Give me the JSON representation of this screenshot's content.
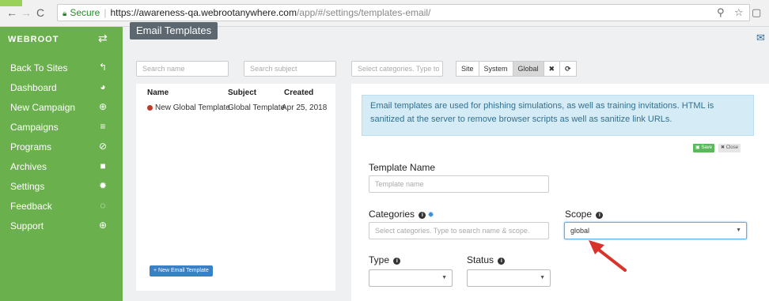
{
  "browser": {
    "secure_label": "Secure",
    "url_host": "https://awareness-qa.webrootanywhere.com",
    "url_path": "/app/#/settings/templates-email/"
  },
  "sidebar": {
    "brand": "WEBROOT",
    "items": [
      {
        "label": "Back To Sites",
        "icon": "↰"
      },
      {
        "label": "Dashboard",
        "icon": "◕"
      },
      {
        "label": "New Campaign",
        "icon": "⊕"
      },
      {
        "label": "Campaigns",
        "icon": "≡"
      },
      {
        "label": "Programs",
        "icon": "⊘"
      },
      {
        "label": "Archives",
        "icon": "■"
      },
      {
        "label": "Settings",
        "icon": "✹"
      },
      {
        "label": "Feedback",
        "icon": "◌"
      },
      {
        "label": "Support",
        "icon": "⊕"
      }
    ]
  },
  "page": {
    "title": "Email Templates"
  },
  "filters": {
    "search_name_placeholder": "Search name",
    "search_subject_placeholder": "Search subject",
    "categories_placeholder": "Select categories. Type to",
    "buttons": [
      "Site",
      "System",
      "Global"
    ],
    "clear_icon": "✖",
    "refresh_icon": "⟳"
  },
  "list": {
    "headers": {
      "name": "Name",
      "subject": "Subject",
      "created": "Created"
    },
    "rows": [
      {
        "name": "New Global Template",
        "subject": "Global Template",
        "created": "Apr 25, 2018"
      }
    ],
    "new_button": "+ New Email Template"
  },
  "editor": {
    "info_text": "Email templates are used for phishing simulations, as well as training invitations. HTML is sanitized at the server to remove browser scripts as well as sanitize link URLs.",
    "save_label": "Save",
    "close_label": "✖ Close",
    "template_name_label": "Template Name",
    "template_name_placeholder": "Template name",
    "categories_label": "Categories",
    "categories_placeholder": "Select categories. Type to search name & scope.",
    "scope_label": "Scope",
    "scope_value": "global",
    "type_label": "Type",
    "status_label": "Status"
  },
  "colors": {
    "sidebar": "#6ab04c",
    "arrow": "#d9342b"
  }
}
